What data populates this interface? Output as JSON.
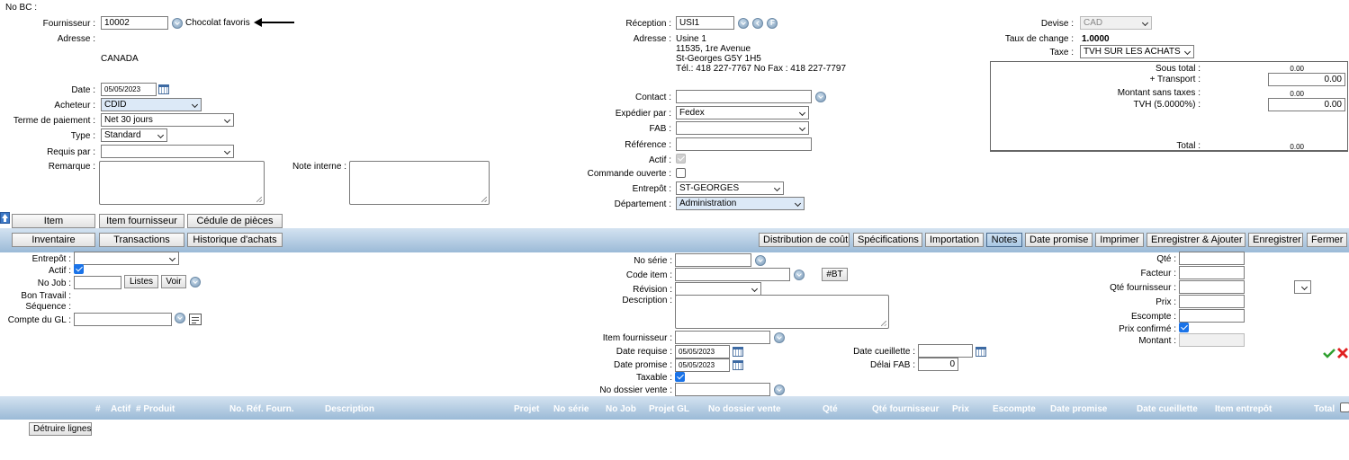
{
  "header": {
    "no_bc_label": "No BC :"
  },
  "supplier": {
    "label": "Fournisseur :",
    "code": "10002",
    "name": "Chocolat favoris",
    "address_label": "Adresse :",
    "country": "CANADA"
  },
  "form_left": {
    "date_label": "Date :",
    "date_value": "05/05/2023",
    "buyer_label": "Acheteur :",
    "buyer_value": "CDID",
    "terms_label": "Terme de paiement :",
    "terms_value": "Net 30 jours",
    "type_label": "Type :",
    "type_value": "Standard",
    "requested_label": "Requis par :",
    "requested_value": "",
    "remark_label": "Remarque :",
    "internal_note_label": "Note interne :"
  },
  "reception": {
    "label": "Réception :",
    "value": "USI1",
    "address_label": "Adresse :",
    "address_lines": [
      "Usine 1",
      "11535, 1re Avenue",
      "St-Georges  G5Y 1H5",
      "Tél.: 418 227-7767    No Fax : 418 227-7797"
    ]
  },
  "form_mid": {
    "contact_label": "Contact :",
    "ship_label": "Expédier par :",
    "ship_value": "Fedex",
    "fab_label": "FAB :",
    "fab_value": "",
    "ref_label": "Référence :",
    "active_label": "Actif :",
    "open_order_label": "Commande ouverte :",
    "warehouse_label": "Entrepôt :",
    "warehouse_value": "ST-GEORGES",
    "dept_label": "Département :",
    "dept_value": "Administration"
  },
  "currency": {
    "label": "Devise :",
    "value": "CAD",
    "rate_label": "Taux de change :",
    "rate_value": "1.0000",
    "tax_label": "Taxe :",
    "tax_value": "TVH SUR LES ACHATS"
  },
  "totals": {
    "subtotal_label": "Sous total :",
    "subtotal_value": "0.00",
    "transport_label": "+ Transport :",
    "transport_value": "0.00",
    "notax_label": "Montant sans taxes :",
    "notax_value": "0.00",
    "tvh_label": "TVH (5.0000%) :",
    "tvh_value": "0.00",
    "total_label": "Total :",
    "total_value": "0.00"
  },
  "tabs_row1": [
    "Item",
    "Item fournisseur",
    "Cédule de pièces"
  ],
  "tabs_row2": [
    "Inventaire",
    "Transactions",
    "Historique d'achats"
  ],
  "toolbar": [
    "Distribution de coût",
    "Spécifications",
    "Importation",
    "Notes",
    "Date promise",
    "Imprimer",
    "Enregistrer & Ajouter",
    "Enregistrer",
    "Fermer"
  ],
  "line_left": {
    "warehouse_label": "Entrepôt :",
    "active_label": "Actif :",
    "job_label": "No Job :",
    "list_btn": "Listes",
    "view_btn": "Voir",
    "work_order_label": "Bon Travail :",
    "sequence_label": "Séquence :",
    "gl_label": "Compte du GL :"
  },
  "line_mid": {
    "serial_label": "No série :",
    "item_code_label": "Code item :",
    "bt_btn": "#BT",
    "revision_label": "Révision :",
    "description_label": "Description :",
    "supplier_item_label": "Item fournisseur :",
    "date_req_label": "Date requise :",
    "date_req_value": "05/05/2023",
    "date_prom_label": "Date promise :",
    "date_prom_value": "05/05/2023",
    "taxable_label": "Taxable :",
    "sales_file_label": "No dossier vente :",
    "pick_date_label": "Date cueillette :",
    "fab_delay_label": "Délai FAB :",
    "fab_delay_value": "0"
  },
  "line_right": {
    "qty_label": "Qté :",
    "factor_label": "Facteur :",
    "supplier_qty_label": "Qté fournisseur :",
    "price_label": "Prix :",
    "discount_label": "Escompte :",
    "price_confirmed_label": "Prix confirmé :",
    "amount_label": "Montant :"
  },
  "grid_headers": [
    "#",
    "Actif",
    "# Produit",
    "No. Réf. Fourn.",
    "Description",
    "Projet",
    "No série",
    "No Job",
    "Projet GL",
    "No dossier vente",
    "Qté",
    "Qté fournisseur",
    "Prix",
    "Escompte",
    "Date promise",
    "Date cueillette",
    "Item entrepôt",
    "Total"
  ],
  "delete_lines_btn": "Détruire lignes",
  "colors": {
    "band": "#9bbad7",
    "accent": "#1a73e8"
  }
}
